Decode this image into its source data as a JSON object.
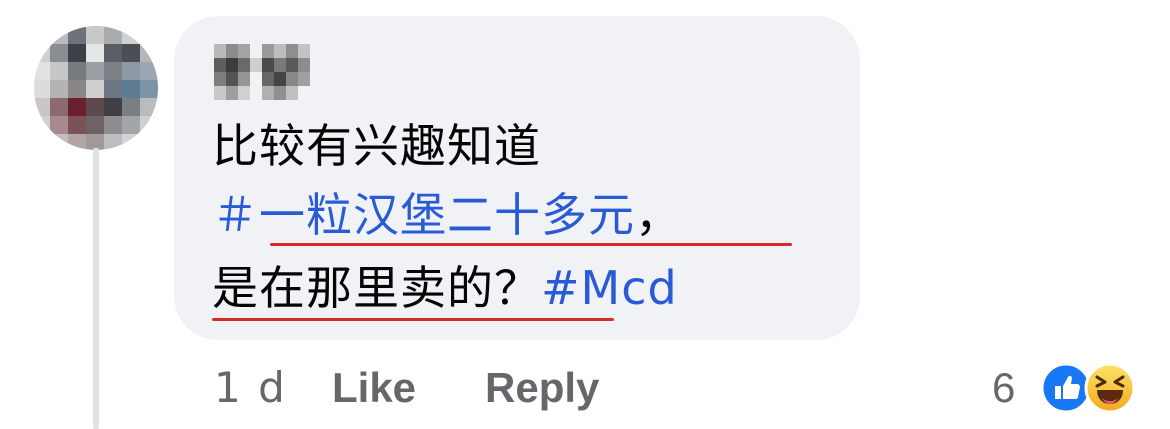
{
  "comment": {
    "lines": {
      "line1": "比较有兴趣知道",
      "line2_tag": "＃一粒汉堡二十多元",
      "line2_punct": "，",
      "line3_text": "是在那里卖的？",
      "line3_tag": "#Mcd"
    }
  },
  "actions": {
    "time": "1 d",
    "like": "Like",
    "reply": "Reply"
  },
  "reactions": {
    "count": "6",
    "icons": [
      "like-icon",
      "haha-icon"
    ],
    "colors": {
      "like": "#1877f2",
      "haha": "#f7b928"
    }
  },
  "colors": {
    "bubble": "#f0f2f5",
    "hashtag": "#2a5bd7",
    "underline": "#d92a2a",
    "muted": "#65676b"
  }
}
